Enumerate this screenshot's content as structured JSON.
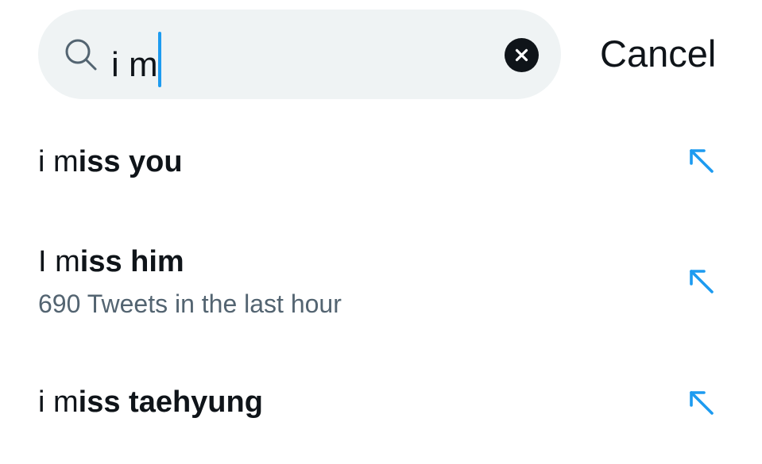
{
  "search": {
    "icon": "search-icon",
    "query": "i m",
    "clear_icon": "close-circle-icon",
    "caret_color": "#1d9bf0"
  },
  "cancel_label": "Cancel",
  "suggestions": [
    {
      "typed": "i m",
      "completion": "iss you",
      "subtitle": "",
      "icon": "arrow-up-left-icon"
    },
    {
      "typed": "I m",
      "completion": "iss him",
      "subtitle": "690 Tweets in the last hour",
      "icon": "arrow-up-left-icon"
    },
    {
      "typed": "i m",
      "completion": "iss taehyung",
      "subtitle": "",
      "icon": "arrow-up-left-icon"
    }
  ],
  "colors": {
    "search_bg": "#eff3f4",
    "text": "#0f1419",
    "secondary_text": "#536471",
    "accent": "#1d9bf0"
  }
}
